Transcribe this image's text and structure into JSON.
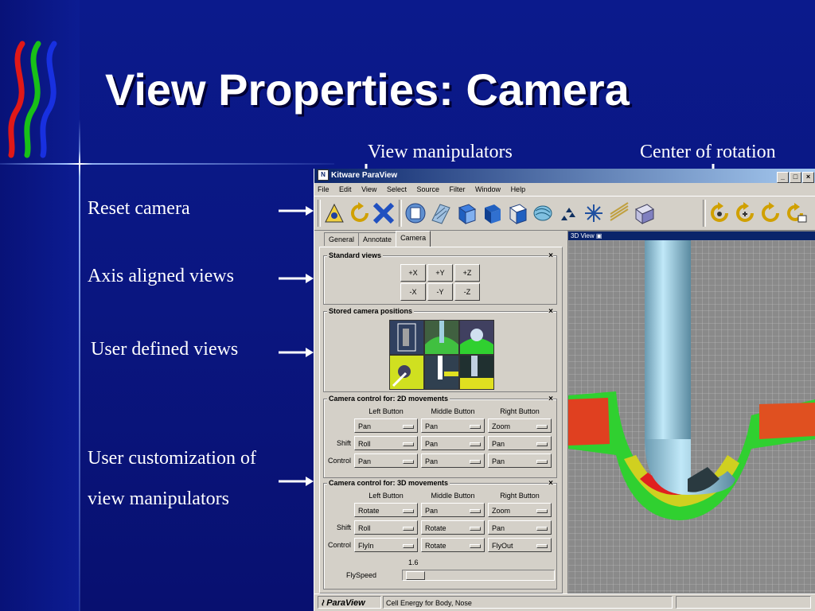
{
  "slide": {
    "title": "View Properties: Camera",
    "annotations": {
      "view_manipulators": "View manipulators",
      "center_of_rotation": "Center of rotation",
      "reset_camera": "Reset camera",
      "axis_aligned_views": "Axis aligned views",
      "user_defined_views": "User defined views",
      "user_customization_line1": "User customization of",
      "user_customization_line2": "view manipulators"
    }
  },
  "window": {
    "title": "Kitware ParaView",
    "app_icon": "paraview-icon",
    "controls": [
      "_",
      "□",
      "×"
    ]
  },
  "menu": [
    "File",
    "Edit",
    "View",
    "Select",
    "Source",
    "Filter",
    "Window",
    "Help"
  ],
  "tabs": [
    "General",
    "Annotate",
    "Camera"
  ],
  "active_tab": "Camera",
  "standard_views": {
    "title": "Standard views",
    "close": "×",
    "buttons": [
      "+X",
      "+Y",
      "+Z",
      "-X",
      "-Y",
      "-Z"
    ]
  },
  "stored_camera": {
    "title": "Stored camera positions",
    "close": "×"
  },
  "camera_2d": {
    "title": "Camera control for: 2D movements",
    "close": "×",
    "columns": [
      "Left Button",
      "Middle Button",
      "Right Button"
    ],
    "rows": [
      {
        "label": "",
        "values": [
          "Pan",
          "Pan",
          "Zoom"
        ]
      },
      {
        "label": "Shift",
        "values": [
          "Roll",
          "Pan",
          "Pan"
        ]
      },
      {
        "label": "Control",
        "values": [
          "Pan",
          "Pan",
          "Pan"
        ]
      }
    ]
  },
  "camera_3d": {
    "title": "Camera control for: 3D movements",
    "close": "×",
    "columns": [
      "Left Button",
      "Middle Button",
      "Right Button"
    ],
    "rows": [
      {
        "label": "",
        "values": [
          "Rotate",
          "Pan",
          "Zoom"
        ]
      },
      {
        "label": "Shift",
        "values": [
          "Roll",
          "Rotate",
          "Pan"
        ]
      },
      {
        "label": "Control",
        "values": [
          "FlyIn",
          "Rotate",
          "FlyOut"
        ]
      }
    ],
    "flyspeed_label": "FlySpeed",
    "flyspeed_value": "1.6"
  },
  "view3d": {
    "title": "3D View"
  },
  "statusbar": {
    "logo": "ParaView",
    "message": "Cell Energy for Body, Nose"
  },
  "colors": {
    "background": "#0b1a8c",
    "window_face": "#d4d0c8",
    "titlebar": "#0a246a"
  }
}
